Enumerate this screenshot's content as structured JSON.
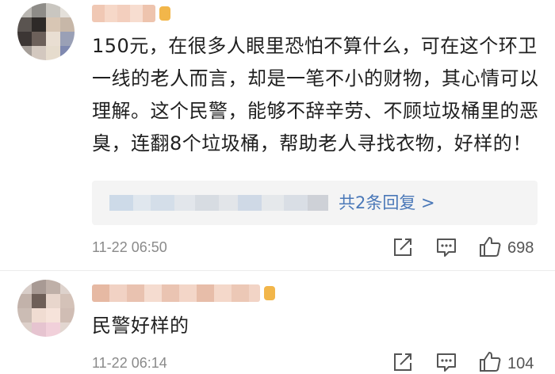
{
  "comments": [
    {
      "text": "150元，在很多人眼里恐怕不算什么，可在这个环卫一线的老人而言，却是一笔不小的财物，其心情可以理解。这个民警，能够不辞辛劳、不顾垃圾桶里的恶臭，连翻8个垃圾桶，帮助老人寻找衣物，好样的！",
      "reply_link": "共2条回复 >",
      "time": "11-22 06:50",
      "likes": "698"
    },
    {
      "text": "民警好样的",
      "time": "11-22 06:14",
      "likes": "104"
    }
  ],
  "icons": {
    "share": "share-icon",
    "comment": "comment-icon",
    "like": "thumbs-up-icon"
  },
  "colors": {
    "link": "#4a78b8",
    "time": "#8a8a8a",
    "vip_badge": "#f2b64a"
  }
}
